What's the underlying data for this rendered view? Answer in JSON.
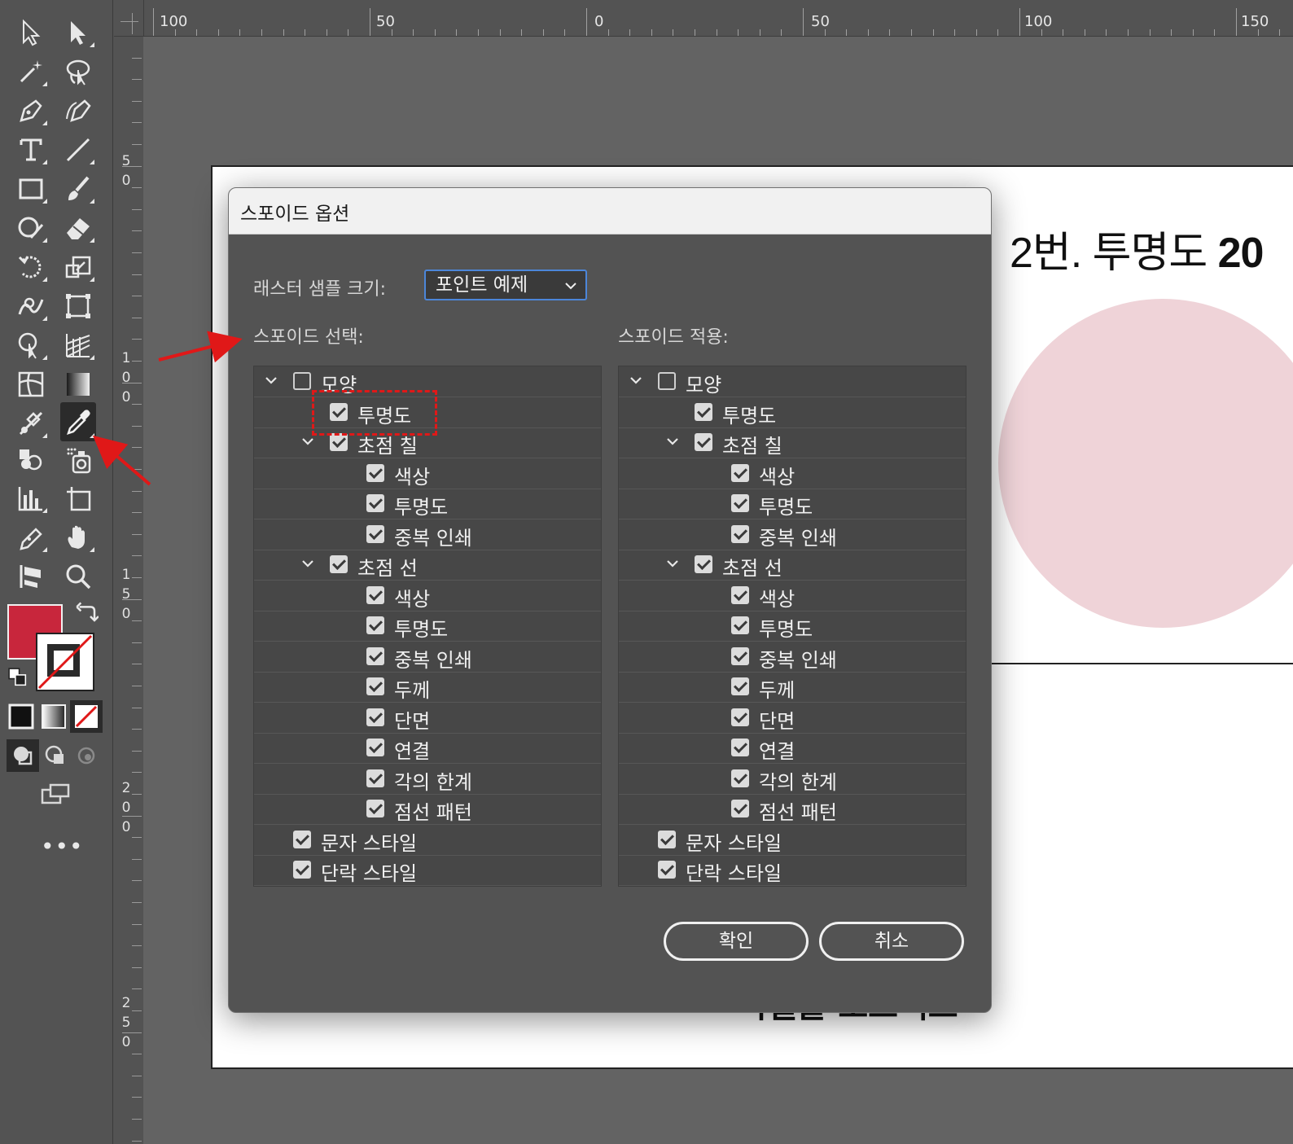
{
  "rulers": {
    "horizontal": [
      "100",
      "50",
      "0",
      "50",
      "100",
      "150"
    ],
    "vertical": [
      "50",
      "100",
      "150",
      "200",
      "250"
    ]
  },
  "artboard": {
    "title_regular": "2번. 투명도 ",
    "title_bold": "20",
    "circle_color": "#efd3d8",
    "bottom_text": "픽셀을 오브젝트"
  },
  "toolbar": {
    "tools": [
      "selection",
      "direct-selection",
      "magic-wand",
      "lasso",
      "pen",
      "curvature",
      "type",
      "line-segment",
      "rectangle",
      "paintbrush",
      "shaper",
      "eraser",
      "rotate",
      "scale",
      "warp",
      "free-transform",
      "shape-builder",
      "perspective-grid",
      "mesh",
      "gradient",
      "blend",
      "eyedropper",
      "symbol-sprayer",
      "graph",
      "column-graph",
      "artboard",
      "slice",
      "hand",
      "rotate-view",
      "zoom"
    ],
    "fill_color": "#c8263c",
    "stroke_color": "none"
  },
  "dialog": {
    "title": "스포이드 옵션",
    "raster_label": "래스터 샘플 크기:",
    "raster_value": "포인트 예제",
    "left_label": "스포이드 선택:",
    "right_label": "스포이드 적용:",
    "rows": [
      {
        "label": "모양",
        "checked": false,
        "level": 0,
        "expand": true
      },
      {
        "label": "투명도",
        "checked": true,
        "level": 1,
        "expand": false
      },
      {
        "label": "초점 칠",
        "checked": true,
        "level": 1,
        "expand": true
      },
      {
        "label": "색상",
        "checked": true,
        "level": 2,
        "expand": false
      },
      {
        "label": "투명도",
        "checked": true,
        "level": 2,
        "expand": false
      },
      {
        "label": "중복 인쇄",
        "checked": true,
        "level": 2,
        "expand": false
      },
      {
        "label": "초점 선",
        "checked": true,
        "level": 1,
        "expand": true
      },
      {
        "label": "색상",
        "checked": true,
        "level": 2,
        "expand": false
      },
      {
        "label": "투명도",
        "checked": true,
        "level": 2,
        "expand": false
      },
      {
        "label": "중복 인쇄",
        "checked": true,
        "level": 2,
        "expand": false
      },
      {
        "label": "두께",
        "checked": true,
        "level": 2,
        "expand": false
      },
      {
        "label": "단면",
        "checked": true,
        "level": 2,
        "expand": false
      },
      {
        "label": "연결",
        "checked": true,
        "level": 2,
        "expand": false
      },
      {
        "label": "각의 한계",
        "checked": true,
        "level": 2,
        "expand": false
      },
      {
        "label": "점선 패턴",
        "checked": true,
        "level": 2,
        "expand": false
      },
      {
        "label": "문자 스타일",
        "checked": true,
        "level": 0,
        "expand": false
      },
      {
        "label": "단락 스타일",
        "checked": true,
        "level": 0,
        "expand": false
      }
    ],
    "ok_label": "확인",
    "cancel_label": "취소"
  },
  "annotation": {
    "color": "#e01818"
  }
}
